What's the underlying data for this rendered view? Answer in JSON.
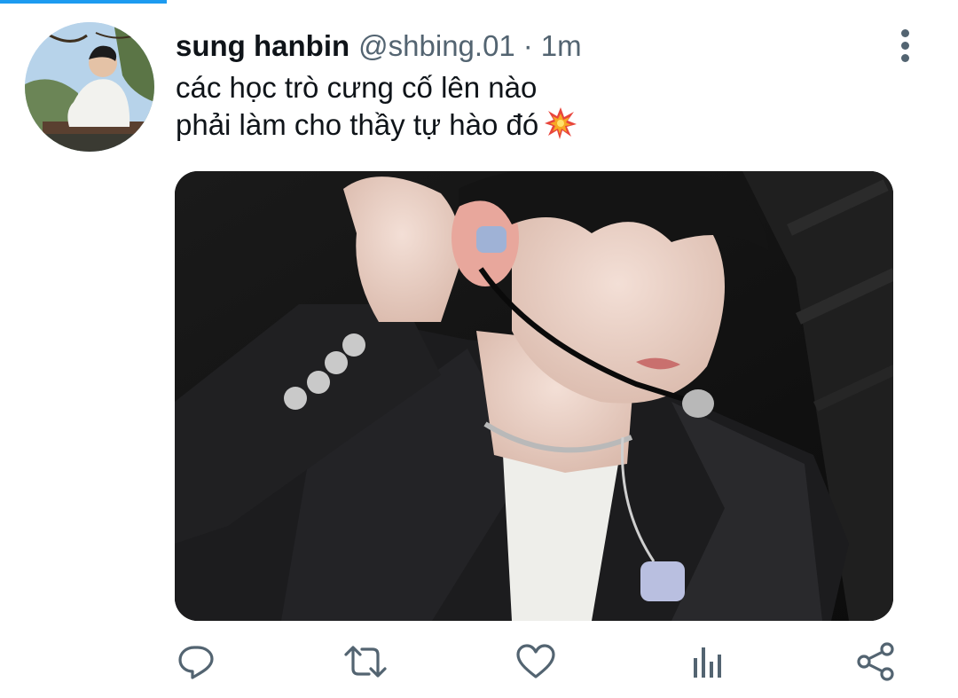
{
  "tweet": {
    "display_name": "sung hanbin",
    "handle": "@shbing.01",
    "separator": "·",
    "time": "1m",
    "text_lines": [
      "các học trò cưng cố lên nào",
      "phải làm cho thầy tự hào đó"
    ],
    "emoji_icon": "collision-emoji",
    "media_description_icon": "photo"
  },
  "icons": {
    "more": "more-vertical-icon",
    "reply": "reply-icon",
    "retweet": "retweet-icon",
    "like": "like-icon",
    "views": "views-icon",
    "share": "share-icon"
  },
  "colors": {
    "accent": "#1d9bf0",
    "icon": "#536471",
    "text": "#0f1419"
  }
}
